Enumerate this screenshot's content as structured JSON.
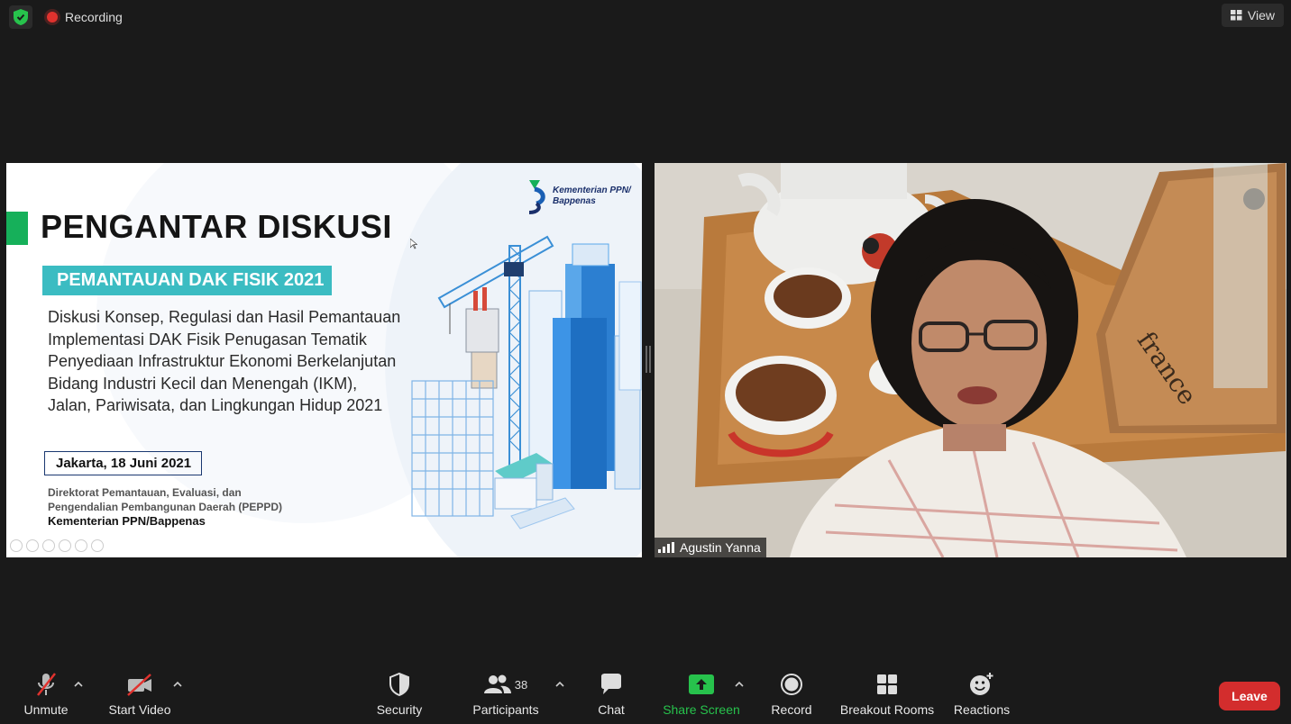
{
  "topbar": {
    "recording_label": "Recording",
    "view_label": "View"
  },
  "slide": {
    "title": "PENGANTAR DISKUSI",
    "subtitle": "PEMANTAUAN DAK FISIK 2021",
    "body_lines": [
      "Diskusi Konsep, Regulasi dan Hasil Pemantauan",
      "Implementasi DAK Fisik Penugasan Tematik",
      "Penyediaan Infrastruktur Ekonomi Berkelanjutan",
      "Bidang Industri Kecil dan Menengah (IKM),",
      "Jalan, Pariwisata, dan Lingkungan Hidup 2021"
    ],
    "date": "Jakarta, 18 Juni 2021",
    "dept_line1": "Direktorat Pemantauan, Evaluasi, dan",
    "dept_line2": "Pengendalian Pembangunan Daerah (PEPPD)",
    "ministry": "Kementerian PPN/Bappenas",
    "logo_line1": "Kementerian PPN/",
    "logo_line2": "Bappenas",
    "accent_color": "#16b05a",
    "subtitle_color": "#3bbcc2"
  },
  "participant": {
    "name": "Agustin Yanna"
  },
  "toolbar": {
    "unmute": "Unmute",
    "start_video": "Start Video",
    "security": "Security",
    "participants": "Participants",
    "participants_count": "38",
    "chat": "Chat",
    "share_screen": "Share Screen",
    "record": "Record",
    "breakout_rooms": "Breakout Rooms",
    "reactions": "Reactions",
    "leave": "Leave",
    "share_color": "#27c24c",
    "leave_color": "#d32d2d"
  }
}
